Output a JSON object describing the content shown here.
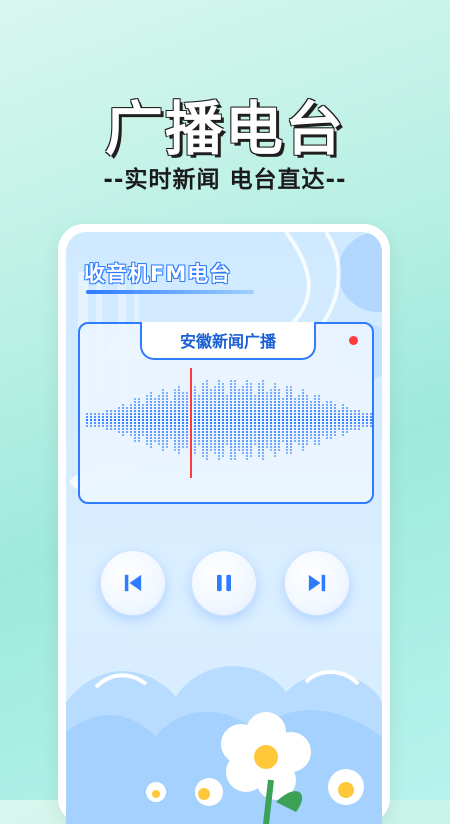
{
  "hero": {
    "title": "广播电台",
    "subtitle": "--实时新闻 电台直达--"
  },
  "app": {
    "title": "收音机FM电台"
  },
  "player": {
    "station_name": "安徽新闻广播",
    "recording": true,
    "controls": [
      {
        "name": "previous",
        "icon": "skip-previous-icon"
      },
      {
        "name": "pause",
        "icon": "pause-icon"
      },
      {
        "name": "next",
        "icon": "skip-next-icon"
      }
    ]
  },
  "colors": {
    "accent_blue": "#2f7cff",
    "record_red": "#ff3b3b"
  }
}
